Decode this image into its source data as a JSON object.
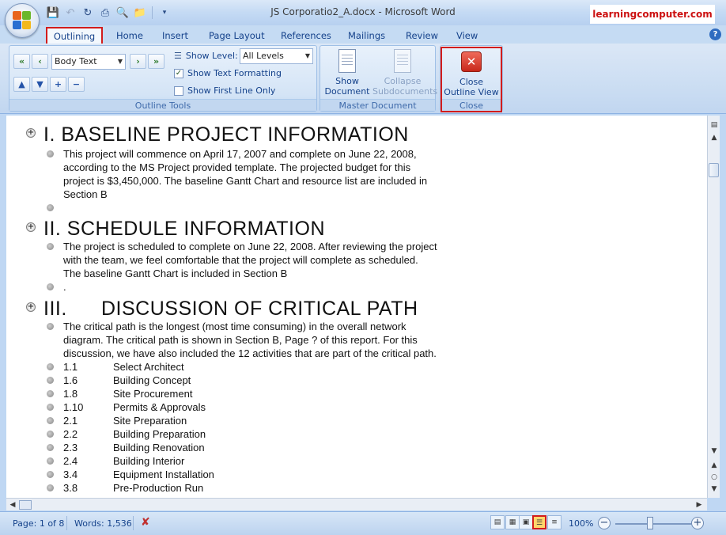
{
  "window": {
    "title": "JS Corporatio2_A.docx - Microsoft Word",
    "brand": "learningcomputer.com"
  },
  "tabs": [
    {
      "label": "Outlining"
    },
    {
      "label": "Home"
    },
    {
      "label": "Insert"
    },
    {
      "label": "Page Layout"
    },
    {
      "label": "References"
    },
    {
      "label": "Mailings"
    },
    {
      "label": "Review"
    },
    {
      "label": "View"
    }
  ],
  "ribbon": {
    "outline_tools": {
      "group_label": "Outline Tools",
      "level_combo": "Body Text",
      "show_level_label": "Show Level:",
      "show_level_value": "All Levels",
      "show_text_formatting": "Show Text Formatting",
      "show_first_line_only": "Show First Line Only"
    },
    "master_document": {
      "group_label": "Master Document",
      "show_document": [
        "Show",
        "Document"
      ],
      "collapse_subdocuments": [
        "Collapse",
        "Subdocuments"
      ]
    },
    "close": {
      "group_label": "Close",
      "close_outline_view": [
        "Close",
        "Outline View"
      ]
    }
  },
  "document": {
    "sections": [
      {
        "heading": "I. BASELINE PROJECT INFORMATION",
        "body": [
          "This project will commence on April 17, 2007 and complete on June 22, 2008,",
          "according to the MS Project provided template. The projected budget for this",
          "project is $3,450,000. The baseline Gantt Chart and resource list are included in",
          "Section B"
        ],
        "trailing": ""
      },
      {
        "heading": "II. SCHEDULE INFORMATION",
        "body": [
          "The project is scheduled to complete on June 22, 2008. After reviewing the project",
          "with the team, we feel comfortable that the project will complete as scheduled.",
          "The baseline Gantt Chart is included in Section B"
        ],
        "trailing": "."
      },
      {
        "heading_num": "III.",
        "heading_text": "DISCUSSION OF CRITICAL PATH",
        "body": [
          "The critical path is the longest (most time consuming) in the overall network",
          "diagram. The critical path is shown in Section B, Page ? of this report. For this",
          "discussion, we have also included the 12 activities that are part of the critical path."
        ]
      }
    ],
    "activities": [
      {
        "num": "1.1",
        "name": "Select Architect"
      },
      {
        "num": "1.6",
        "name": "Building Concept"
      },
      {
        "num": "1.8",
        "name": "Site Procurement"
      },
      {
        "num": "1.10",
        "name": "Permits & Approvals"
      },
      {
        "num": "2.1",
        "name": "Site Preparation"
      },
      {
        "num": "2.2",
        "name": "Building Preparation"
      },
      {
        "num": "2.3",
        "name": "Building Renovation"
      },
      {
        "num": "2.4",
        "name": "Building Interior"
      },
      {
        "num": "3.4",
        "name": "Equipment Installation"
      },
      {
        "num": "3.8",
        "name": "Pre-Production Run"
      }
    ]
  },
  "status": {
    "page": "Page: 1 of 8",
    "words": "Words: 1,536",
    "zoom": "100%"
  },
  "icons": {
    "office_button": "office-logo-icon",
    "save": "save-icon",
    "undo": "undo-icon",
    "redo": "redo-icon",
    "print": "print-icon",
    "print_preview": "print-preview-icon",
    "open": "open-folder-icon",
    "help": "help-icon"
  },
  "colors": {
    "highlight_border": "#d21c1c",
    "ribbon_text": "#15428b",
    "brand_text": "#cc1111"
  }
}
